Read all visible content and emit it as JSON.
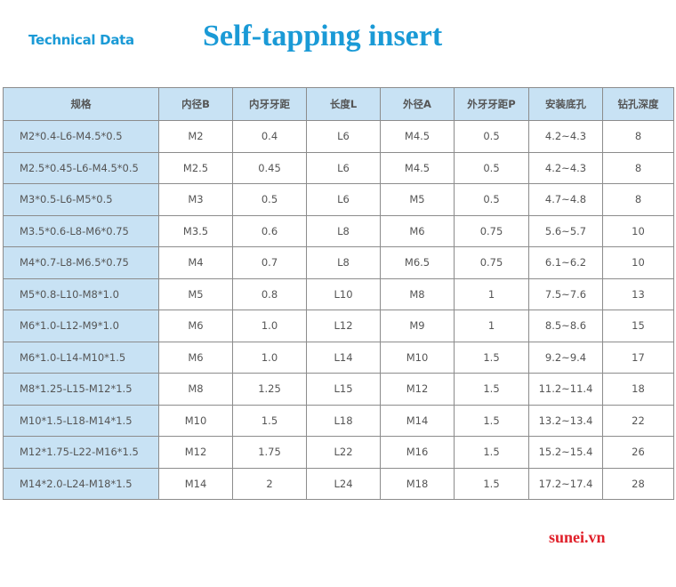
{
  "header": {
    "section_label": "Technical Data",
    "title": "Self-tapping insert"
  },
  "table": {
    "columns": [
      "规格",
      "内径B",
      "内牙牙距",
      "长度L",
      "外径A",
      "外牙牙距P",
      "安装底孔",
      "钻孔深度"
    ],
    "rows": [
      [
        "M2*0.4-L6-M4.5*0.5",
        "M2",
        "0.4",
        "L6",
        "M4.5",
        "0.5",
        "4.2~4.3",
        "8"
      ],
      [
        "M2.5*0.45-L6-M4.5*0.5",
        "M2.5",
        "0.45",
        "L6",
        "M4.5",
        "0.5",
        "4.2~4.3",
        "8"
      ],
      [
        "M3*0.5-L6-M5*0.5",
        "M3",
        "0.5",
        "L6",
        "M5",
        "0.5",
        "4.7~4.8",
        "8"
      ],
      [
        "M3.5*0.6-L8-M6*0.75",
        "M3.5",
        "0.6",
        "L8",
        "M6",
        "0.75",
        "5.6~5.7",
        "10"
      ],
      [
        "M4*0.7-L8-M6.5*0.75",
        "M4",
        "0.7",
        "L8",
        "M6.5",
        "0.75",
        "6.1~6.2",
        "10"
      ],
      [
        "M5*0.8-L10-M8*1.0",
        "M5",
        "0.8",
        "L10",
        "M8",
        "1",
        "7.5~7.6",
        "13"
      ],
      [
        "M6*1.0-L12-M9*1.0",
        "M6",
        "1.0",
        "L12",
        "M9",
        "1",
        "8.5~8.6",
        "15"
      ],
      [
        "M6*1.0-L14-M10*1.5",
        "M6",
        "1.0",
        "L14",
        "M10",
        "1.5",
        "9.2~9.4",
        "17"
      ],
      [
        "M8*1.25-L15-M12*1.5",
        "M8",
        "1.25",
        "L15",
        "M12",
        "1.5",
        "11.2~11.4",
        "18"
      ],
      [
        "M10*1.5-L18-M14*1.5",
        "M10",
        "1.5",
        "L18",
        "M14",
        "1.5",
        "13.2~13.4",
        "22"
      ],
      [
        "M12*1.75-L22-M16*1.5",
        "M12",
        "1.75",
        "L22",
        "M16",
        "1.5",
        "15.2~15.4",
        "26"
      ],
      [
        "M14*2.0-L24-M18*1.5",
        "M14",
        "2",
        "L24",
        "M18",
        "1.5",
        "17.2~17.4",
        "28"
      ]
    ]
  },
  "footer": {
    "watermark": "sunei.vn"
  },
  "colors": {
    "title_blue": "#1a9ad6",
    "header_fill": "#c8e2f4",
    "watermark_red": "#e0202a"
  }
}
